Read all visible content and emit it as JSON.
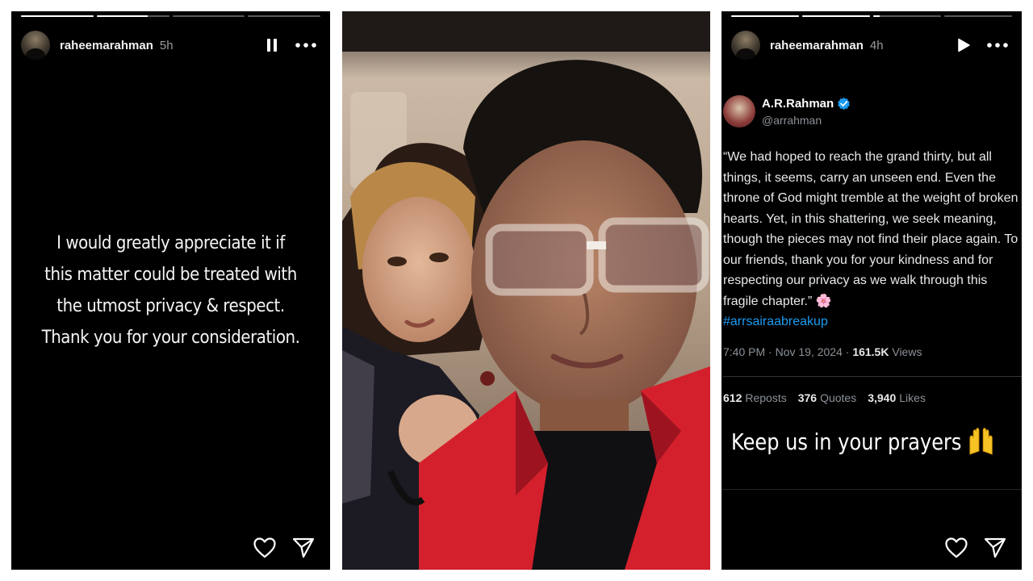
{
  "left_story": {
    "username": "raheemarahman",
    "age": "5h",
    "progress": [
      1,
      0.7,
      0,
      0
    ],
    "caption_lines": [
      "I would greatly appreciate it if",
      "this matter could be treated with",
      "the utmost privacy & respect.",
      "Thank you for your consideration."
    ],
    "icons": {
      "pause": "pause-icon",
      "more": "more-icon",
      "like": "heart-icon",
      "share": "send-icon"
    }
  },
  "middle_photo": {
    "description_icon": "photo"
  },
  "right_story": {
    "username": "raheemarahman",
    "age": "4h",
    "progress": [
      1,
      1,
      0.1,
      0
    ],
    "icons": {
      "play": "play-icon",
      "more": "more-icon",
      "like": "heart-icon",
      "share": "send-icon"
    },
    "tweet": {
      "name": "A.R.Rahman",
      "handle": "@arrahman",
      "body": "“We had hoped to reach the grand thirty, but all things, it seems, carry an unseen end. Even the throne of God might tremble at the weight of broken hearts. Yet, in this shattering, we seek meaning, though the pieces may not find their place again. To our friends, thank you for your kindness and for respecting our privacy as we walk through this fragile chapter.”",
      "hashtag": "#arrsairaabreakup",
      "time": "7:40 PM · Nov 19, 2024 · ",
      "views_count": "161.5K",
      "views_label": " Views",
      "reposts_count": "612",
      "reposts_label": "Reposts",
      "quotes_count": "376",
      "quotes_label": "Quotes",
      "likes_count": "3,940",
      "likes_label": "Likes"
    },
    "sticker_text": "Keep us in your prayers"
  },
  "colors": {
    "story_bg": "#000000",
    "link_blue": "#1d9bf0",
    "jacket_red": "#d4202c"
  }
}
